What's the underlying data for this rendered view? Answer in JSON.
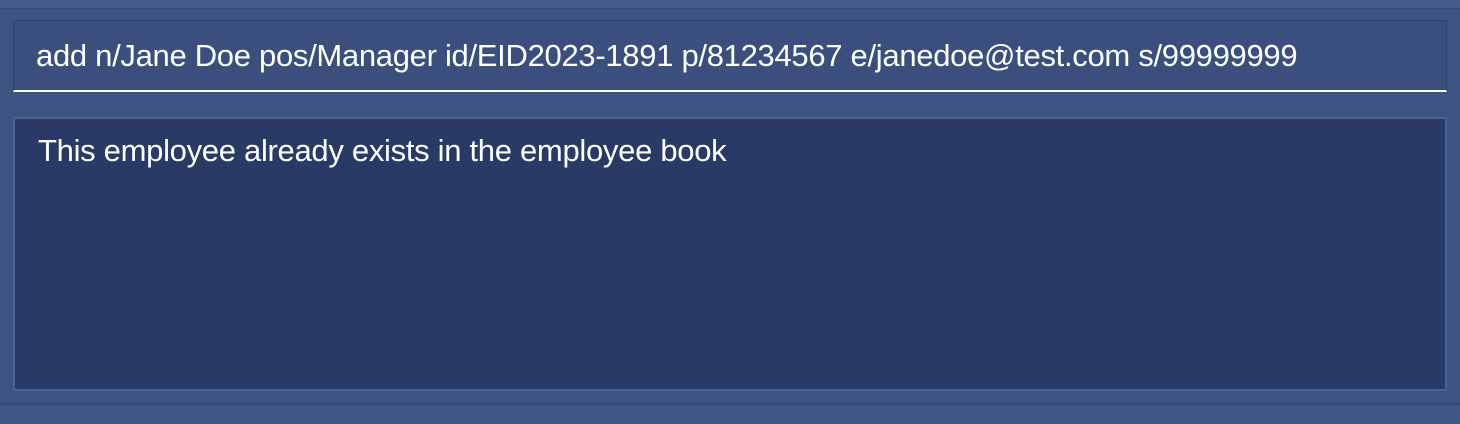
{
  "command_box": {
    "value": "add n/Jane Doe pos/Manager id/EID2023-1891 p/81234567 e/janedoe@test.com s/99999999"
  },
  "result_display": {
    "message": "This employee already exists in the employee book"
  },
  "colors": {
    "background": "#3d5382",
    "result_panel": "#2a3a66",
    "text": "#ffffff"
  }
}
